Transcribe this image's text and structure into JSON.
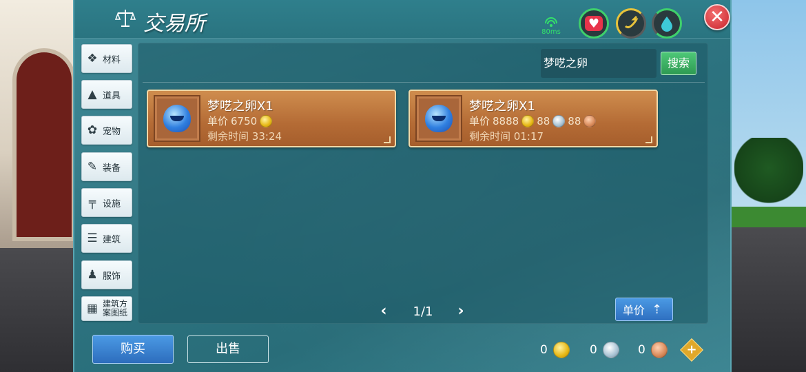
{
  "header": {
    "title": "交易所",
    "icon": "scale-icon",
    "ping_label": "80ms",
    "close_label": "✕"
  },
  "status": {
    "heart_icon": "heart-icon",
    "energy_icon": "energy-icon",
    "water_icon": "water-drop-icon"
  },
  "sidebar": {
    "items": [
      {
        "label": "材料",
        "icon": "material-icon"
      },
      {
        "label": "道具",
        "icon": "item-icon"
      },
      {
        "label": "宠物",
        "icon": "pet-paw-icon"
      },
      {
        "label": "装备",
        "icon": "equipment-icon"
      },
      {
        "label": "设施",
        "icon": "facility-icon"
      },
      {
        "label": "建筑",
        "icon": "building-icon"
      },
      {
        "label": "服饰",
        "icon": "clothing-icon"
      },
      {
        "label": "建筑方案图纸",
        "icon": "blueprint-icon"
      }
    ]
  },
  "search": {
    "value": "梦呓之卵",
    "button_label": "搜索"
  },
  "listings": [
    {
      "name": "梦呓之卵X1",
      "price_label": "单价",
      "gold": "6750",
      "time_label": "剩余时间",
      "time_left": "33:24"
    },
    {
      "name": "梦呓之卵X1",
      "price_label": "单价",
      "gold": "8888",
      "silver": "88",
      "copper": "88",
      "time_label": "剩余时间",
      "time_left": "01:17"
    }
  ],
  "pager": {
    "prev": "‹",
    "label": "1/1",
    "next": "›"
  },
  "sort": {
    "label": "单价"
  },
  "footer": {
    "buy_label": "购买",
    "sell_label": "出售",
    "gold_amount": "0",
    "silver_amount": "0",
    "copper_amount": "0"
  }
}
